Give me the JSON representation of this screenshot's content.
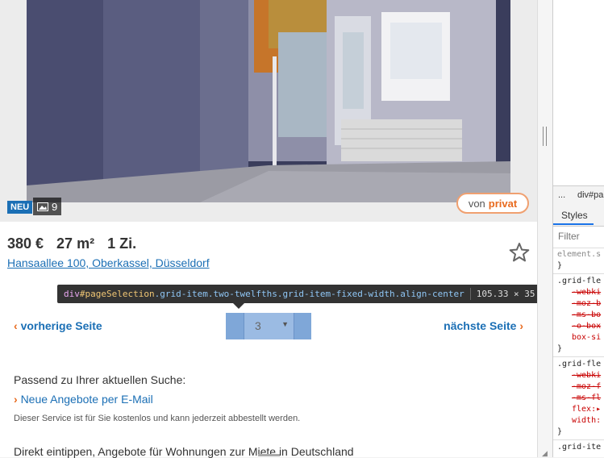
{
  "listing": {
    "badge_new": "NEU",
    "photo_count": "9",
    "seller_badge_von": "von",
    "seller_badge_type": "privat",
    "price": "380 €",
    "size": "27 m²",
    "rooms": "1 Zi.",
    "address": "Hansaallee 100, Oberkassel, Düsseldorf"
  },
  "pagination": {
    "prev_label": "vorherige Seite",
    "next_label": "nächste Seite",
    "page_value": "3"
  },
  "inspector_tooltip": {
    "tag": "div",
    "id": "#pageSelection",
    "classes": ".grid-item.two-twelfths.grid-item-fixed-width.align-center",
    "dimensions": "105.33 × 35"
  },
  "suggestion": {
    "title": "Passend zu Ihrer aktuellen Suche:",
    "link": "Neue Angebote per E-Mail",
    "note": "Dieser Service ist für Sie kostenlos und kann jederzeit abbestellt werden.",
    "more": "Direkt eintippen, Angebote für Wohnungen zur Miete in Deutschland"
  },
  "devtools": {
    "breadcrumb_more": "...",
    "breadcrumb_item": "div#pa",
    "tab_styles": "Styles",
    "filter_placeholder": "Filter",
    "rules": [
      {
        "selector": "element.s",
        "close": "}"
      },
      {
        "selector": ".grid-fle",
        "props": [
          "-webki",
          "-moz-b",
          "-ms-bo",
          "-o-box",
          "box-si"
        ],
        "close": "}"
      },
      {
        "selector": ".grid-fle",
        "props": [
          "-webki",
          "-moz-f",
          "-ms-fl",
          "flex:▸",
          "width:"
        ],
        "close": "}"
      },
      {
        "selector": ".grid-ite"
      }
    ]
  },
  "colors": {
    "link_blue": "#1b6fb5",
    "accent_orange": "#e86a1e",
    "highlight_blue": "#9bbbe3"
  }
}
